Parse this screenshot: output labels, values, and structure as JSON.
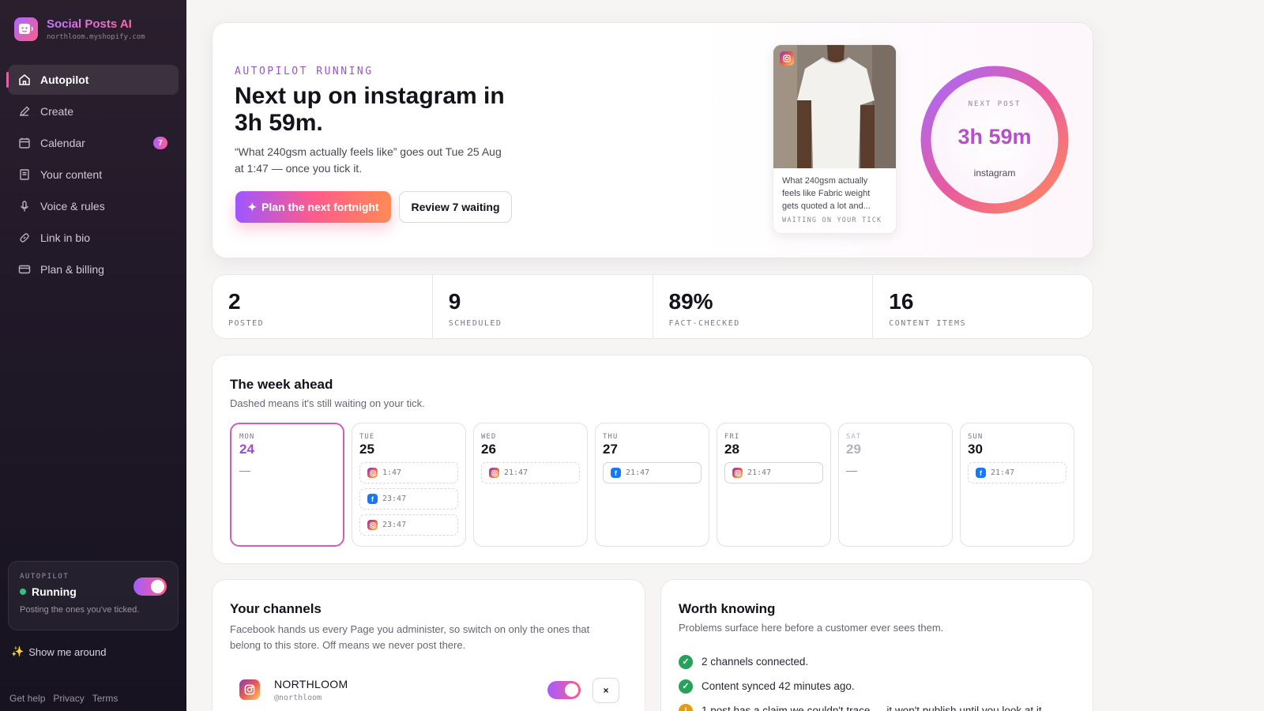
{
  "brand": {
    "name": "Social Posts AI",
    "store": "northloom.myshopify.com"
  },
  "nav": {
    "items": [
      {
        "label": "Autopilot",
        "icon": "home-icon",
        "active": true
      },
      {
        "label": "Create",
        "icon": "pencil-icon"
      },
      {
        "label": "Calendar",
        "icon": "calendar-icon",
        "badge": "7"
      },
      {
        "label": "Your content",
        "icon": "document-icon"
      },
      {
        "label": "Voice & rules",
        "icon": "microphone-icon"
      },
      {
        "label": "Link in bio",
        "icon": "link-icon"
      },
      {
        "label": "Plan & billing",
        "icon": "credit-card-icon"
      }
    ]
  },
  "autopilot_card": {
    "label": "AUTOPILOT",
    "status": "Running",
    "description": "Posting the ones you've ticked.",
    "enabled": true
  },
  "show_around": "Show me around",
  "footer": {
    "help": "Get help",
    "privacy": "Privacy",
    "terms": "Terms"
  },
  "hero": {
    "eyebrow": "AUTOPILOT RUNNING",
    "title": "Next up on instagram in 3h 59m.",
    "description": "“What 240gsm actually feels like” goes out Tue 25 Aug at 1:47 — once you tick it.",
    "primary_button": "Plan the next fortnight",
    "secondary_button": "Review 7 waiting",
    "preview": {
      "text": "What 240gsm actually feels like Fabric weight gets quoted a lot and...",
      "status": "WAITING ON YOUR TICK",
      "platform_icon": "instagram-icon"
    },
    "countdown": {
      "eyebrow": "NEXT POST",
      "time": "3h 59m",
      "platform": "instagram"
    }
  },
  "stats": [
    {
      "value": "2",
      "label": "POSTED"
    },
    {
      "value": "9",
      "label": "SCHEDULED"
    },
    {
      "value": "89%",
      "label": "FACT-CHECKED"
    },
    {
      "value": "16",
      "label": "CONTENT ITEMS"
    }
  ],
  "week": {
    "title": "The week ahead",
    "subtitle": "Dashed means it's still waiting on your tick.",
    "days": [
      {
        "name": "MON",
        "num": "24",
        "today": true,
        "empty": "—",
        "slots": []
      },
      {
        "name": "TUE",
        "num": "25",
        "slots": [
          {
            "platform": "instagram",
            "time": "1:47",
            "pending": true
          },
          {
            "platform": "facebook",
            "time": "23:47",
            "pending": true
          },
          {
            "platform": "instagram",
            "time": "23:47",
            "pending": true
          }
        ]
      },
      {
        "name": "WED",
        "num": "26",
        "slots": [
          {
            "platform": "instagram",
            "time": "21:47",
            "pending": true
          }
        ]
      },
      {
        "name": "THU",
        "num": "27",
        "slots": [
          {
            "platform": "facebook",
            "time": "21:47",
            "pending": false
          }
        ]
      },
      {
        "name": "FRI",
        "num": "28",
        "slots": [
          {
            "platform": "instagram",
            "time": "21:47",
            "pending": false
          }
        ]
      },
      {
        "name": "SAT",
        "num": "29",
        "muted": true,
        "empty": "—",
        "slots": []
      },
      {
        "name": "SUN",
        "num": "30",
        "slots": [
          {
            "platform": "facebook",
            "time": "21:47",
            "pending": true
          }
        ]
      }
    ]
  },
  "channels": {
    "title": "Your channels",
    "description": "Facebook hands us every Page you administer, so switch on only the ones that belong to this store. Off means we never post there.",
    "items": [
      {
        "name": "NORTHLOOM",
        "handle": "@northloom",
        "platform": "instagram",
        "enabled": true,
        "remove": "×"
      }
    ]
  },
  "worth_knowing": {
    "title": "Worth knowing",
    "subtitle": "Problems surface here before a customer ever sees them.",
    "items": [
      {
        "status": "ok",
        "text": "2 channels connected."
      },
      {
        "status": "ok",
        "text": "Content synced 42 minutes ago."
      },
      {
        "status": "warn",
        "text": "1 post has a claim we couldn't trace — it won't publish until you look at it."
      }
    ]
  },
  "colors": {
    "accent_purple": "#9d57ff",
    "accent_pink": "#ff5b8c",
    "sidebar_bg": "#1e1726",
    "ok_green": "#27a25a",
    "warn_orange": "#e59b12"
  }
}
